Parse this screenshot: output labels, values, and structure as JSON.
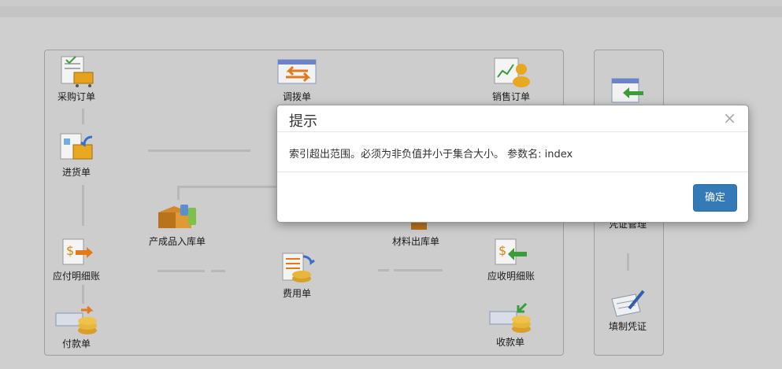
{
  "flow": {
    "purchase_order": "采购订单",
    "transfer_order": "调拨单",
    "sales_order": "销售订单",
    "goods_receipt": "进货单",
    "finished_goods_in": "产成品入库单",
    "material_out": "材料出库单",
    "payable_ledger": "应付明细账",
    "receivable_ledger": "应收明细账",
    "expense_bill": "费用单",
    "payment_bill": "付款单",
    "receipt_bill": "收款单"
  },
  "side": {
    "voucher_manage": "凭证管理",
    "fill_voucher": "填制凭证"
  },
  "modal": {
    "title": "提示",
    "close": "×",
    "message": "索引超出范围。必须为非负值并小于集合大小。 参数名: index",
    "ok_label": "确定"
  }
}
